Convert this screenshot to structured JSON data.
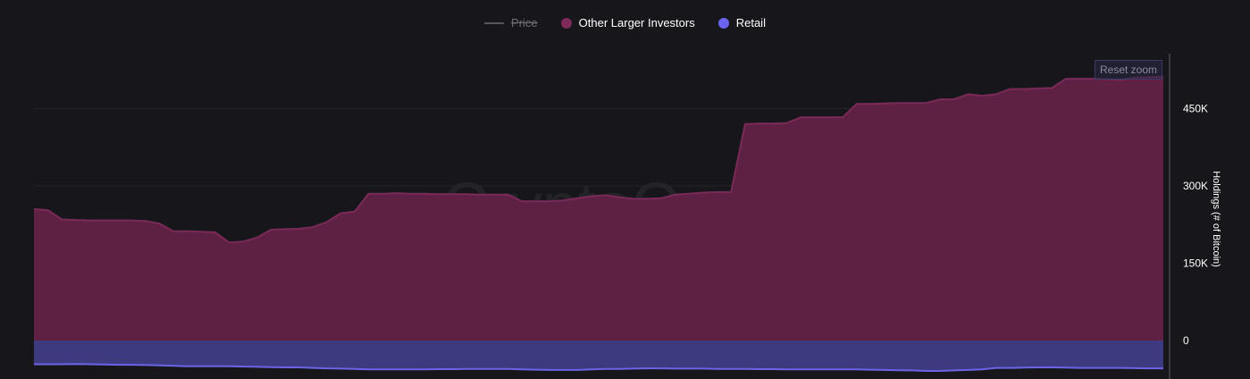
{
  "legend": {
    "price_label": "Price",
    "other_label": "Other Larger Investors",
    "retail_label": "Retail"
  },
  "reset_zoom_label": "Reset zoom",
  "watermark": "CryptoQuant",
  "colors": {
    "other_fill": "#5e2043",
    "other_line": "#7a2a58",
    "other_dot": "#7e2a5a",
    "retail_fill": "#3e3a80",
    "retail_line": "#6b64e6",
    "retail_dot": "#6b64f0",
    "price_line": "#55555c",
    "background": "#17171b",
    "grid": "#232328"
  },
  "chart_data": {
    "type": "area",
    "ylabel": "Holdings (# of Bitcoin)",
    "ylim": [
      -70000,
      540000
    ],
    "yticks": [
      0,
      150000,
      300000,
      450000
    ],
    "ytick_labels": [
      "0",
      "150K",
      "300K",
      "450K"
    ],
    "grid": true,
    "legend_position": "top-center",
    "series": [
      {
        "name": "Other Larger Investors",
        "values": [
          255000,
          253000,
          235000,
          234000,
          233000,
          233000,
          233000,
          233000,
          232000,
          227000,
          212000,
          212000,
          211000,
          210000,
          190000,
          192000,
          200000,
          215000,
          216000,
          217000,
          220000,
          230000,
          247000,
          250000,
          285000,
          285000,
          286000,
          285000,
          285000,
          284000,
          284000,
          284000,
          283000,
          283000,
          283000,
          270000,
          270000,
          270000,
          272000,
          276000,
          280000,
          282000,
          278000,
          275000,
          275000,
          276000,
          283000,
          285000,
          287000,
          288000,
          288000,
          420000,
          421000,
          421000,
          422000,
          433000,
          433000,
          433000,
          433000,
          459000,
          459000,
          460000,
          461000,
          461000,
          461000,
          468000,
          468000,
          478000,
          475000,
          478000,
          488000,
          488000,
          489000,
          490000,
          508000,
          508000,
          508000,
          507000,
          506000,
          510000,
          511000,
          512000
        ]
      },
      {
        "name": "Retail",
        "values": [
          -46000,
          -46000,
          -46000,
          -45500,
          -46000,
          -46500,
          -47000,
          -47000,
          -47500,
          -48000,
          -49000,
          -50000,
          -50000,
          -50000,
          -50000,
          -50500,
          -51000,
          -51500,
          -52000,
          -52000,
          -53000,
          -54000,
          -54500,
          -55000,
          -56000,
          -56000,
          -56000,
          -56000,
          -56000,
          -55500,
          -55500,
          -55000,
          -55000,
          -55000,
          -55000,
          -56000,
          -56500,
          -57000,
          -57000,
          -57000,
          -56000,
          -55000,
          -55000,
          -54500,
          -54000,
          -54000,
          -54500,
          -54500,
          -54500,
          -55000,
          -55000,
          -55000,
          -55500,
          -55500,
          -56000,
          -56000,
          -56000,
          -56000,
          -56000,
          -56000,
          -56500,
          -57000,
          -57500,
          -58000,
          -59000,
          -59000,
          -58000,
          -57000,
          -56000,
          -53000,
          -53000,
          -52500,
          -52000,
          -52000,
          -52500,
          -53000,
          -53000,
          -53000,
          -53000,
          -53500,
          -54000,
          -54000
        ]
      }
    ]
  }
}
